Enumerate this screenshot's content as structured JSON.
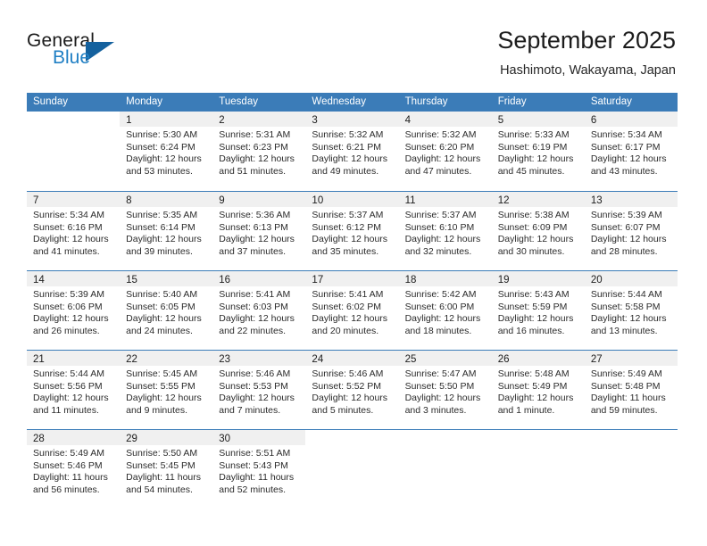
{
  "brand": {
    "word_general": "General",
    "word_blue": "Blue",
    "logo_icon": "triangle-flag-icon",
    "accent_color": "#1f7fc4",
    "triangle_color": "#14619e"
  },
  "header": {
    "title": "September 2025",
    "subtitle": "Hashimoto, Wakayama, Japan"
  },
  "calendar": {
    "header_bg": "#3b7cb8",
    "daynum_bg": "#f0f0f0",
    "weekdays": [
      "Sunday",
      "Monday",
      "Tuesday",
      "Wednesday",
      "Thursday",
      "Friday",
      "Saturday"
    ],
    "weeks": [
      [
        {
          "day": "",
          "blank": true,
          "sunrise": "",
          "sunset": "",
          "daylight1": "",
          "daylight2": ""
        },
        {
          "day": "1",
          "sunrise": "Sunrise: 5:30 AM",
          "sunset": "Sunset: 6:24 PM",
          "daylight1": "Daylight: 12 hours",
          "daylight2": "and 53 minutes."
        },
        {
          "day": "2",
          "sunrise": "Sunrise: 5:31 AM",
          "sunset": "Sunset: 6:23 PM",
          "daylight1": "Daylight: 12 hours",
          "daylight2": "and 51 minutes."
        },
        {
          "day": "3",
          "sunrise": "Sunrise: 5:32 AM",
          "sunset": "Sunset: 6:21 PM",
          "daylight1": "Daylight: 12 hours",
          "daylight2": "and 49 minutes."
        },
        {
          "day": "4",
          "sunrise": "Sunrise: 5:32 AM",
          "sunset": "Sunset: 6:20 PM",
          "daylight1": "Daylight: 12 hours",
          "daylight2": "and 47 minutes."
        },
        {
          "day": "5",
          "sunrise": "Sunrise: 5:33 AM",
          "sunset": "Sunset: 6:19 PM",
          "daylight1": "Daylight: 12 hours",
          "daylight2": "and 45 minutes."
        },
        {
          "day": "6",
          "sunrise": "Sunrise: 5:34 AM",
          "sunset": "Sunset: 6:17 PM",
          "daylight1": "Daylight: 12 hours",
          "daylight2": "and 43 minutes."
        }
      ],
      [
        {
          "day": "7",
          "sunrise": "Sunrise: 5:34 AM",
          "sunset": "Sunset: 6:16 PM",
          "daylight1": "Daylight: 12 hours",
          "daylight2": "and 41 minutes."
        },
        {
          "day": "8",
          "sunrise": "Sunrise: 5:35 AM",
          "sunset": "Sunset: 6:14 PM",
          "daylight1": "Daylight: 12 hours",
          "daylight2": "and 39 minutes."
        },
        {
          "day": "9",
          "sunrise": "Sunrise: 5:36 AM",
          "sunset": "Sunset: 6:13 PM",
          "daylight1": "Daylight: 12 hours",
          "daylight2": "and 37 minutes."
        },
        {
          "day": "10",
          "sunrise": "Sunrise: 5:37 AM",
          "sunset": "Sunset: 6:12 PM",
          "daylight1": "Daylight: 12 hours",
          "daylight2": "and 35 minutes."
        },
        {
          "day": "11",
          "sunrise": "Sunrise: 5:37 AM",
          "sunset": "Sunset: 6:10 PM",
          "daylight1": "Daylight: 12 hours",
          "daylight2": "and 32 minutes."
        },
        {
          "day": "12",
          "sunrise": "Sunrise: 5:38 AM",
          "sunset": "Sunset: 6:09 PM",
          "daylight1": "Daylight: 12 hours",
          "daylight2": "and 30 minutes."
        },
        {
          "day": "13",
          "sunrise": "Sunrise: 5:39 AM",
          "sunset": "Sunset: 6:07 PM",
          "daylight1": "Daylight: 12 hours",
          "daylight2": "and 28 minutes."
        }
      ],
      [
        {
          "day": "14",
          "sunrise": "Sunrise: 5:39 AM",
          "sunset": "Sunset: 6:06 PM",
          "daylight1": "Daylight: 12 hours",
          "daylight2": "and 26 minutes."
        },
        {
          "day": "15",
          "sunrise": "Sunrise: 5:40 AM",
          "sunset": "Sunset: 6:05 PM",
          "daylight1": "Daylight: 12 hours",
          "daylight2": "and 24 minutes."
        },
        {
          "day": "16",
          "sunrise": "Sunrise: 5:41 AM",
          "sunset": "Sunset: 6:03 PM",
          "daylight1": "Daylight: 12 hours",
          "daylight2": "and 22 minutes."
        },
        {
          "day": "17",
          "sunrise": "Sunrise: 5:41 AM",
          "sunset": "Sunset: 6:02 PM",
          "daylight1": "Daylight: 12 hours",
          "daylight2": "and 20 minutes."
        },
        {
          "day": "18",
          "sunrise": "Sunrise: 5:42 AM",
          "sunset": "Sunset: 6:00 PM",
          "daylight1": "Daylight: 12 hours",
          "daylight2": "and 18 minutes."
        },
        {
          "day": "19",
          "sunrise": "Sunrise: 5:43 AM",
          "sunset": "Sunset: 5:59 PM",
          "daylight1": "Daylight: 12 hours",
          "daylight2": "and 16 minutes."
        },
        {
          "day": "20",
          "sunrise": "Sunrise: 5:44 AM",
          "sunset": "Sunset: 5:58 PM",
          "daylight1": "Daylight: 12 hours",
          "daylight2": "and 13 minutes."
        }
      ],
      [
        {
          "day": "21",
          "sunrise": "Sunrise: 5:44 AM",
          "sunset": "Sunset: 5:56 PM",
          "daylight1": "Daylight: 12 hours",
          "daylight2": "and 11 minutes."
        },
        {
          "day": "22",
          "sunrise": "Sunrise: 5:45 AM",
          "sunset": "Sunset: 5:55 PM",
          "daylight1": "Daylight: 12 hours",
          "daylight2": "and 9 minutes."
        },
        {
          "day": "23",
          "sunrise": "Sunrise: 5:46 AM",
          "sunset": "Sunset: 5:53 PM",
          "daylight1": "Daylight: 12 hours",
          "daylight2": "and 7 minutes."
        },
        {
          "day": "24",
          "sunrise": "Sunrise: 5:46 AM",
          "sunset": "Sunset: 5:52 PM",
          "daylight1": "Daylight: 12 hours",
          "daylight2": "and 5 minutes."
        },
        {
          "day": "25",
          "sunrise": "Sunrise: 5:47 AM",
          "sunset": "Sunset: 5:50 PM",
          "daylight1": "Daylight: 12 hours",
          "daylight2": "and 3 minutes."
        },
        {
          "day": "26",
          "sunrise": "Sunrise: 5:48 AM",
          "sunset": "Sunset: 5:49 PM",
          "daylight1": "Daylight: 12 hours",
          "daylight2": "and 1 minute."
        },
        {
          "day": "27",
          "sunrise": "Sunrise: 5:49 AM",
          "sunset": "Sunset: 5:48 PM",
          "daylight1": "Daylight: 11 hours",
          "daylight2": "and 59 minutes."
        }
      ],
      [
        {
          "day": "28",
          "sunrise": "Sunrise: 5:49 AM",
          "sunset": "Sunset: 5:46 PM",
          "daylight1": "Daylight: 11 hours",
          "daylight2": "and 56 minutes."
        },
        {
          "day": "29",
          "sunrise": "Sunrise: 5:50 AM",
          "sunset": "Sunset: 5:45 PM",
          "daylight1": "Daylight: 11 hours",
          "daylight2": "and 54 minutes."
        },
        {
          "day": "30",
          "sunrise": "Sunrise: 5:51 AM",
          "sunset": "Sunset: 5:43 PM",
          "daylight1": "Daylight: 11 hours",
          "daylight2": "and 52 minutes."
        },
        {
          "day": "",
          "blank": true,
          "sunrise": "",
          "sunset": "",
          "daylight1": "",
          "daylight2": ""
        },
        {
          "day": "",
          "blank": true,
          "sunrise": "",
          "sunset": "",
          "daylight1": "",
          "daylight2": ""
        },
        {
          "day": "",
          "blank": true,
          "sunrise": "",
          "sunset": "",
          "daylight1": "",
          "daylight2": ""
        },
        {
          "day": "",
          "blank": true,
          "sunrise": "",
          "sunset": "",
          "daylight1": "",
          "daylight2": ""
        }
      ]
    ]
  }
}
